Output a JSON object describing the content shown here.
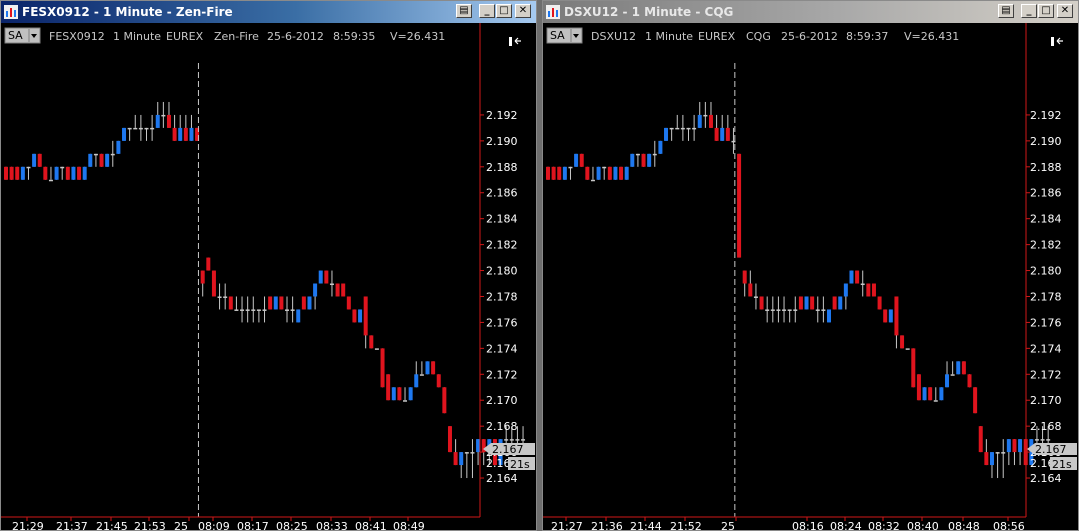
{
  "colors": {
    "up": "#1e78f0",
    "down": "#e0141e",
    "flat": "#c8c8c8",
    "axis_line": "#d01818",
    "bg": "#000000"
  },
  "icons": [
    "chart-icon",
    "restore-icon",
    "minimize-icon",
    "maximize-icon",
    "close-icon",
    "dropdown-arrow-icon",
    "scroll-to-end-icon"
  ],
  "windows": [
    {
      "title": "FESX0912 - 1 Minute - Zen-Fire",
      "style_button": "SA",
      "info": {
        "instrument": "FESX0912",
        "period": "1 Minute",
        "exchange": "EUREX",
        "provider": "Zen-Fire",
        "date": "25-6-2012",
        "time": "8:59:35",
        "volume": "V=26.431"
      },
      "price_label": "2.167",
      "countdown_label": "21s",
      "partial_price_label": "2.16",
      "time_labels": [
        "21:29",
        "21:37",
        "21:45",
        "21:53",
        "25",
        "08:09",
        "08:17",
        "08:25",
        "08:33",
        "08:41",
        "08:49"
      ]
    },
    {
      "title": "DSXU12 - 1 Minute - CQG",
      "style_button": "SA",
      "info": {
        "instrument": "DSXU12",
        "period": "1 Minute",
        "exchange": "EUREX",
        "provider": "CQG",
        "date": "25-6-2012",
        "time": "8:59:37",
        "volume": "V=26.431"
      },
      "price_label": "2.167",
      "countdown_label": "21s",
      "partial_price_label": "2.16",
      "time_labels": [
        "21:27",
        "21:36",
        "21:44",
        "21:52",
        "25",
        "08:16",
        "08:24",
        "08:32",
        "08:40",
        "08:48",
        "08:56"
      ]
    }
  ],
  "chart_data": [
    {
      "type": "bar",
      "title": "FESX0912 - 1 Minute - Zen-Fire",
      "y_ticks": [
        "2.192",
        "2.190",
        "2.188",
        "2.186",
        "2.184",
        "2.182",
        "2.180",
        "2.178",
        "2.176",
        "2.174",
        "2.172",
        "2.170",
        "2.168",
        "2.166",
        "2.164"
      ],
      "ylim": [
        2.163,
        2.194
      ],
      "session_break_index": 34,
      "bars": [
        [
          2.188,
          2.188,
          2.187,
          2.187
        ],
        [
          2.188,
          2.188,
          2.187,
          2.187
        ],
        [
          2.188,
          2.188,
          2.187,
          2.187
        ],
        [
          2.187,
          2.188,
          2.187,
          2.188
        ],
        [
          2.188,
          2.188,
          2.187,
          2.188
        ],
        [
          2.188,
          2.189,
          2.188,
          2.189
        ],
        [
          2.189,
          2.189,
          2.188,
          2.188
        ],
        [
          2.188,
          2.188,
          2.187,
          2.187
        ],
        [
          2.187,
          2.188,
          2.187,
          2.187
        ],
        [
          2.187,
          2.188,
          2.187,
          2.188
        ],
        [
          2.188,
          2.188,
          2.187,
          2.188
        ],
        [
          2.188,
          2.188,
          2.187,
          2.187
        ],
        [
          2.187,
          2.188,
          2.187,
          2.188
        ],
        [
          2.188,
          2.188,
          2.187,
          2.187
        ],
        [
          2.187,
          2.188,
          2.187,
          2.188
        ],
        [
          2.188,
          2.189,
          2.188,
          2.189
        ],
        [
          2.189,
          2.189,
          2.188,
          2.189
        ],
        [
          2.189,
          2.189,
          2.188,
          2.188
        ],
        [
          2.188,
          2.189,
          2.188,
          2.189
        ],
        [
          2.189,
          2.19,
          2.188,
          2.189
        ],
        [
          2.189,
          2.19,
          2.189,
          2.19
        ],
        [
          2.19,
          2.191,
          2.19,
          2.191
        ],
        [
          2.191,
          2.191,
          2.19,
          2.191
        ],
        [
          2.191,
          2.192,
          2.191,
          2.191
        ],
        [
          2.191,
          2.192,
          2.19,
          2.191
        ],
        [
          2.191,
          2.191,
          2.19,
          2.191
        ],
        [
          2.191,
          2.192,
          2.19,
          2.191
        ],
        [
          2.191,
          2.193,
          2.191,
          2.192
        ],
        [
          2.192,
          2.193,
          2.191,
          2.192
        ],
        [
          2.192,
          2.193,
          2.191,
          2.191
        ],
        [
          2.191,
          2.192,
          2.19,
          2.19
        ],
        [
          2.19,
          2.192,
          2.19,
          2.191
        ],
        [
          2.191,
          2.192,
          2.19,
          2.19
        ],
        [
          2.19,
          2.192,
          2.19,
          2.191
        ],
        [
          2.191,
          2.191,
          2.19,
          2.19
        ],
        [
          2.18,
          2.18,
          2.178,
          2.179
        ],
        [
          2.181,
          2.181,
          2.18,
          2.18
        ],
        [
          2.18,
          2.18,
          2.178,
          2.178
        ],
        [
          2.178,
          2.179,
          2.177,
          2.178
        ],
        [
          2.178,
          2.179,
          2.177,
          2.178
        ],
        [
          2.178,
          2.178,
          2.177,
          2.177
        ],
        [
          2.177,
          2.178,
          2.177,
          2.177
        ],
        [
          2.177,
          2.178,
          2.176,
          2.177
        ],
        [
          2.177,
          2.178,
          2.176,
          2.177
        ],
        [
          2.177,
          2.178,
          2.176,
          2.177
        ],
        [
          2.177,
          2.177,
          2.176,
          2.177
        ],
        [
          2.177,
          2.178,
          2.176,
          2.177
        ],
        [
          2.178,
          2.178,
          2.177,
          2.177
        ],
        [
          2.177,
          2.178,
          2.177,
          2.178
        ],
        [
          2.178,
          2.178,
          2.177,
          2.177
        ],
        [
          2.177,
          2.178,
          2.176,
          2.177
        ],
        [
          2.177,
          2.178,
          2.176,
          2.177
        ],
        [
          2.176,
          2.177,
          2.176,
          2.177
        ],
        [
          2.178,
          2.178,
          2.177,
          2.177
        ],
        [
          2.177,
          2.178,
          2.177,
          2.178
        ],
        [
          2.178,
          2.179,
          2.177,
          2.179
        ],
        [
          2.179,
          2.18,
          2.179,
          2.18
        ],
        [
          2.18,
          2.18,
          2.179,
          2.179
        ],
        [
          2.179,
          2.18,
          2.178,
          2.179
        ],
        [
          2.179,
          2.179,
          2.178,
          2.178
        ],
        [
          2.179,
          2.179,
          2.178,
          2.178
        ],
        [
          2.178,
          2.178,
          2.177,
          2.177
        ],
        [
          2.177,
          2.177,
          2.176,
          2.176
        ],
        [
          2.176,
          2.177,
          2.176,
          2.177
        ],
        [
          2.178,
          2.178,
          2.174,
          2.175
        ],
        [
          2.175,
          2.175,
          2.174,
          2.174
        ],
        [
          2.174,
          2.174,
          2.174,
          2.174
        ],
        [
          2.174,
          2.174,
          2.171,
          2.171
        ],
        [
          2.172,
          2.172,
          2.17,
          2.17
        ],
        [
          2.17,
          2.171,
          2.17,
          2.171
        ],
        [
          2.171,
          2.171,
          2.17,
          2.17
        ],
        [
          2.17,
          2.171,
          2.17,
          2.17
        ],
        [
          2.17,
          2.171,
          2.17,
          2.171
        ],
        [
          2.171,
          2.173,
          2.171,
          2.172
        ],
        [
          2.172,
          2.173,
          2.172,
          2.172
        ],
        [
          2.172,
          2.173,
          2.172,
          2.173
        ],
        [
          2.173,
          2.173,
          2.172,
          2.172
        ],
        [
          2.172,
          2.172,
          2.171,
          2.171
        ],
        [
          2.171,
          2.171,
          2.169,
          2.169
        ],
        [
          2.168,
          2.168,
          2.166,
          2.166
        ],
        [
          2.166,
          2.167,
          2.165,
          2.165
        ],
        [
          2.165,
          2.166,
          2.164,
          2.166
        ],
        [
          2.166,
          2.166,
          2.164,
          2.166
        ],
        [
          2.166,
          2.167,
          2.164,
          2.166
        ],
        [
          2.166,
          2.167,
          2.165,
          2.167
        ],
        [
          2.167,
          2.167,
          2.165,
          2.166
        ],
        [
          2.166,
          2.167,
          2.165,
          2.167
        ],
        [
          2.167,
          2.167,
          2.165,
          2.165
        ],
        [
          2.165,
          2.167,
          2.165,
          2.167
        ],
        [
          2.167,
          2.168,
          2.166,
          2.167
        ],
        [
          2.167,
          2.168,
          2.166,
          2.167
        ],
        [
          2.167,
          2.168,
          2.166,
          2.167
        ],
        [
          2.167,
          2.168,
          2.166,
          2.167
        ]
      ]
    },
    {
      "type": "bar",
      "title": "DSXU12 - 1 Minute - CQG",
      "y_ticks": [
        "2.192",
        "2.190",
        "2.188",
        "2.186",
        "2.184",
        "2.182",
        "2.180",
        "2.178",
        "2.176",
        "2.174",
        "2.172",
        "2.170",
        "2.168",
        "2.166",
        "2.164"
      ],
      "ylim": [
        2.163,
        2.194
      ],
      "session_break_index": 33,
      "bars": [
        [
          2.188,
          2.188,
          2.187,
          2.187
        ],
        [
          2.188,
          2.188,
          2.187,
          2.187
        ],
        [
          2.188,
          2.188,
          2.187,
          2.187
        ],
        [
          2.187,
          2.188,
          2.187,
          2.188
        ],
        [
          2.188,
          2.188,
          2.187,
          2.188
        ],
        [
          2.188,
          2.189,
          2.188,
          2.189
        ],
        [
          2.189,
          2.189,
          2.188,
          2.188
        ],
        [
          2.188,
          2.188,
          2.187,
          2.187
        ],
        [
          2.187,
          2.188,
          2.187,
          2.187
        ],
        [
          2.187,
          2.188,
          2.187,
          2.188
        ],
        [
          2.188,
          2.188,
          2.187,
          2.188
        ],
        [
          2.188,
          2.188,
          2.187,
          2.187
        ],
        [
          2.187,
          2.188,
          2.187,
          2.188
        ],
        [
          2.188,
          2.188,
          2.187,
          2.187
        ],
        [
          2.187,
          2.188,
          2.187,
          2.188
        ],
        [
          2.188,
          2.189,
          2.188,
          2.189
        ],
        [
          2.189,
          2.189,
          2.188,
          2.189
        ],
        [
          2.189,
          2.189,
          2.188,
          2.188
        ],
        [
          2.188,
          2.189,
          2.188,
          2.189
        ],
        [
          2.189,
          2.19,
          2.188,
          2.189
        ],
        [
          2.189,
          2.19,
          2.189,
          2.19
        ],
        [
          2.19,
          2.191,
          2.19,
          2.191
        ],
        [
          2.191,
          2.191,
          2.19,
          2.191
        ],
        [
          2.191,
          2.192,
          2.191,
          2.191
        ],
        [
          2.191,
          2.192,
          2.19,
          2.191
        ],
        [
          2.191,
          2.191,
          2.19,
          2.191
        ],
        [
          2.191,
          2.192,
          2.19,
          2.191
        ],
        [
          2.191,
          2.193,
          2.191,
          2.192
        ],
        [
          2.192,
          2.193,
          2.191,
          2.192
        ],
        [
          2.192,
          2.193,
          2.191,
          2.191
        ],
        [
          2.191,
          2.192,
          2.19,
          2.19
        ],
        [
          2.19,
          2.192,
          2.19,
          2.191
        ],
        [
          2.191,
          2.192,
          2.19,
          2.19
        ],
        [
          2.19,
          2.191,
          2.189,
          2.19
        ],
        [
          2.189,
          2.189,
          2.181,
          2.181
        ],
        [
          2.18,
          2.18,
          2.178,
          2.179
        ],
        [
          2.179,
          2.18,
          2.178,
          2.178
        ],
        [
          2.178,
          2.179,
          2.177,
          2.178
        ],
        [
          2.178,
          2.178,
          2.177,
          2.177
        ],
        [
          2.177,
          2.178,
          2.176,
          2.177
        ],
        [
          2.177,
          2.178,
          2.176,
          2.177
        ],
        [
          2.177,
          2.178,
          2.176,
          2.177
        ],
        [
          2.177,
          2.178,
          2.176,
          2.177
        ],
        [
          2.177,
          2.177,
          2.176,
          2.177
        ],
        [
          2.177,
          2.178,
          2.176,
          2.177
        ],
        [
          2.178,
          2.178,
          2.177,
          2.177
        ],
        [
          2.177,
          2.178,
          2.177,
          2.178
        ],
        [
          2.178,
          2.178,
          2.177,
          2.177
        ],
        [
          2.177,
          2.178,
          2.176,
          2.177
        ],
        [
          2.177,
          2.178,
          2.176,
          2.177
        ],
        [
          2.176,
          2.177,
          2.176,
          2.177
        ],
        [
          2.178,
          2.178,
          2.177,
          2.177
        ],
        [
          2.177,
          2.178,
          2.177,
          2.178
        ],
        [
          2.178,
          2.179,
          2.177,
          2.179
        ],
        [
          2.179,
          2.18,
          2.179,
          2.18
        ],
        [
          2.18,
          2.18,
          2.179,
          2.179
        ],
        [
          2.179,
          2.18,
          2.178,
          2.179
        ],
        [
          2.179,
          2.179,
          2.178,
          2.178
        ],
        [
          2.179,
          2.179,
          2.178,
          2.178
        ],
        [
          2.178,
          2.178,
          2.177,
          2.177
        ],
        [
          2.177,
          2.177,
          2.176,
          2.176
        ],
        [
          2.176,
          2.177,
          2.176,
          2.177
        ],
        [
          2.178,
          2.178,
          2.174,
          2.175
        ],
        [
          2.175,
          2.175,
          2.174,
          2.174
        ],
        [
          2.174,
          2.174,
          2.174,
          2.174
        ],
        [
          2.174,
          2.174,
          2.171,
          2.171
        ],
        [
          2.172,
          2.172,
          2.17,
          2.17
        ],
        [
          2.17,
          2.171,
          2.17,
          2.171
        ],
        [
          2.171,
          2.171,
          2.17,
          2.17
        ],
        [
          2.17,
          2.171,
          2.17,
          2.17
        ],
        [
          2.17,
          2.171,
          2.17,
          2.171
        ],
        [
          2.171,
          2.173,
          2.171,
          2.172
        ],
        [
          2.172,
          2.173,
          2.172,
          2.172
        ],
        [
          2.172,
          2.173,
          2.172,
          2.173
        ],
        [
          2.173,
          2.173,
          2.172,
          2.172
        ],
        [
          2.172,
          2.172,
          2.171,
          2.171
        ],
        [
          2.171,
          2.171,
          2.169,
          2.169
        ],
        [
          2.168,
          2.168,
          2.166,
          2.166
        ],
        [
          2.166,
          2.167,
          2.165,
          2.165
        ],
        [
          2.165,
          2.166,
          2.164,
          2.166
        ],
        [
          2.166,
          2.166,
          2.164,
          2.166
        ],
        [
          2.166,
          2.167,
          2.164,
          2.166
        ],
        [
          2.166,
          2.167,
          2.165,
          2.167
        ],
        [
          2.167,
          2.167,
          2.165,
          2.166
        ],
        [
          2.166,
          2.167,
          2.165,
          2.167
        ],
        [
          2.167,
          2.167,
          2.165,
          2.165
        ],
        [
          2.165,
          2.167,
          2.165,
          2.167
        ],
        [
          2.167,
          2.168,
          2.166,
          2.167
        ],
        [
          2.167,
          2.168,
          2.166,
          2.167
        ],
        [
          2.167,
          2.168,
          2.166,
          2.167
        ]
      ]
    }
  ]
}
